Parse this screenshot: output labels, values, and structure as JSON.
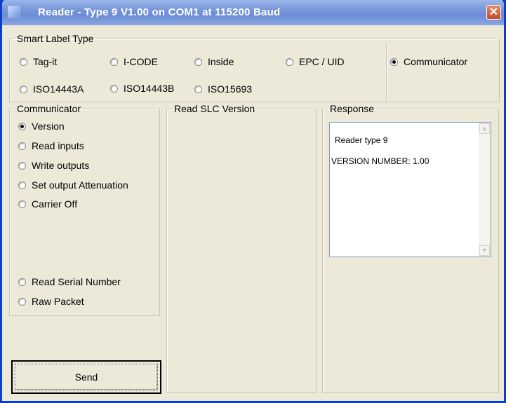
{
  "window": {
    "title": "Reader - Type 9 V1.00 on COM1 at 115200 Baud"
  },
  "smart_label_type": {
    "legend": "Smart Label Type",
    "options": [
      {
        "label": "Tag-it",
        "selected": false
      },
      {
        "label": "I-CODE",
        "selected": false
      },
      {
        "label": "Inside",
        "selected": false
      },
      {
        "label": "EPC / UID",
        "selected": false
      },
      {
        "label": "Communicator",
        "selected": true
      },
      {
        "label": "ISO14443A",
        "selected": false
      },
      {
        "label": "ISO14443B",
        "selected": false
      },
      {
        "label": "ISO15693",
        "selected": false
      }
    ]
  },
  "communicator": {
    "legend": "Communicator",
    "options": [
      {
        "label": "Version",
        "selected": true
      },
      {
        "label": "Read inputs",
        "selected": false
      },
      {
        "label": "Write outputs",
        "selected": false
      },
      {
        "label": "Set output Attenuation",
        "selected": false
      },
      {
        "label": "Carrier Off",
        "selected": false
      },
      {
        "label": "Read Serial Number",
        "selected": false
      },
      {
        "label": "Raw Packet",
        "selected": false
      }
    ]
  },
  "read_slc": {
    "legend": "Read SLC Version"
  },
  "response": {
    "legend": "Response",
    "lines": [
      "Reader type 9",
      "VERSION NUMBER: 1.00"
    ]
  },
  "send_button": {
    "label": "Send"
  }
}
